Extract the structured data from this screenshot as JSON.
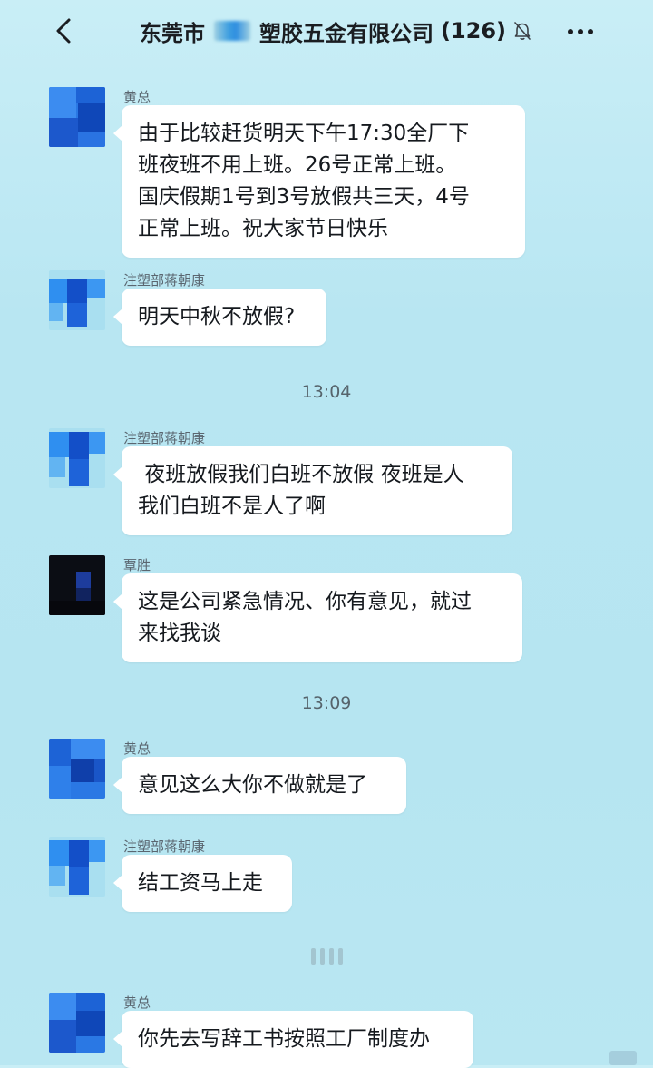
{
  "header": {
    "title_prefix": "东莞市",
    "title_suffix": "塑胶五金有限公司",
    "member_count": "(126)",
    "back_icon": "chevron-left-icon",
    "mute_icon": "bell-off-icon",
    "more_icon": "ellipsis-icon"
  },
  "messages": [
    {
      "sender": "黄总",
      "text_lines": [
        "由于比较赶货明天下午17:30全厂下",
        "班夜班不用上班。26号正常上班。",
        "国庆假期1号到3号放假共三天，4号",
        "正常上班。祝大家节日快乐"
      ]
    },
    {
      "sender": "注塑部蒋朝康",
      "text_lines": [
        "明天中秋不放假?"
      ]
    },
    {
      "sender": "注塑部蒋朝康",
      "text_lines": [
        " 夜班放假我们白班不放假 夜班是人",
        "我们白班不是人了啊"
      ]
    },
    {
      "sender": "覃胜",
      "text_lines": [
        "这是公司紧急情况、你有意见，就过",
        "来找我谈"
      ]
    },
    {
      "sender": "黄总",
      "text_lines": [
        "意见这么大你不做就是了"
      ]
    },
    {
      "sender": "注塑部蒋朝康",
      "text_lines": [
        "结工资马上走"
      ]
    },
    {
      "sender": "黄总",
      "text_lines": [
        "你先去写辞工书按照工厂制度办"
      ]
    }
  ],
  "timestamps": [
    "13:04",
    "13:09"
  ],
  "colors": {
    "background": "#b8e6f2",
    "bubble": "#ffffff",
    "avatar_blue": "#2a6fe0"
  }
}
